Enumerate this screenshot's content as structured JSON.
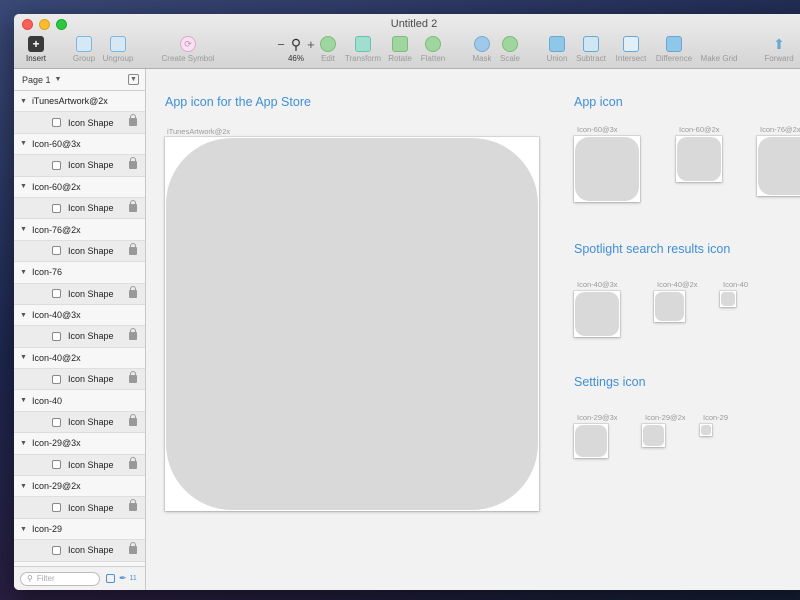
{
  "window": {
    "title": "Untitled 2"
  },
  "toolbar": {
    "insert": "Insert",
    "group": "Group",
    "ungroup": "Ungroup",
    "create_symbol": "Create Symbol",
    "zoom_level": "46%",
    "zoom_out": "−",
    "zoom_in": "+",
    "edit": "Edit",
    "transform": "Transform",
    "rotate": "Rotate",
    "flatten": "Flatten",
    "mask": "Mask",
    "scale": "Scale",
    "union": "Union",
    "subtract": "Subtract",
    "intersect": "Intersect",
    "difference": "Difference",
    "make_grid": "Make Grid",
    "forward": "Forward"
  },
  "sidebar": {
    "page": "Page 1",
    "groups": [
      {
        "name": "iTunesArtwork@2x",
        "child": "Icon Shape"
      },
      {
        "name": "Icon-60@3x",
        "child": "Icon Shape"
      },
      {
        "name": "Icon-60@2x",
        "child": "Icon Shape"
      },
      {
        "name": "Icon-76@2x",
        "child": "Icon Shape"
      },
      {
        "name": "Icon-76",
        "child": "Icon Shape"
      },
      {
        "name": "Icon-40@3x",
        "child": "Icon Shape"
      },
      {
        "name": "Icon-40@2x",
        "child": "Icon Shape"
      },
      {
        "name": "Icon-40",
        "child": "Icon Shape"
      },
      {
        "name": "Icon-29@3x",
        "child": "Icon Shape"
      },
      {
        "name": "Icon-29@2x",
        "child": "Icon Shape"
      },
      {
        "name": "Icon-29",
        "child": "Icon Shape"
      }
    ],
    "filter_placeholder": "Filter",
    "filter_count": "11"
  },
  "canvas": {
    "app_store_title": "App icon for the App Store",
    "app_store_artboard": "iTunesArtwork@2x",
    "app_icon_title": "App icon",
    "app_icon_artboards": [
      "Icon-60@3x",
      "Icon-60@2x",
      "Icon-76@2x"
    ],
    "spotlight_title": "Spotlight search results icon",
    "spotlight_artboards": [
      "Icon-40@3x",
      "Icon-40@2x",
      "Icon-40"
    ],
    "settings_title": "Settings icon",
    "settings_artboards": [
      "Icon-29@3x",
      "Icon-29@2x",
      "Icon-29"
    ]
  }
}
